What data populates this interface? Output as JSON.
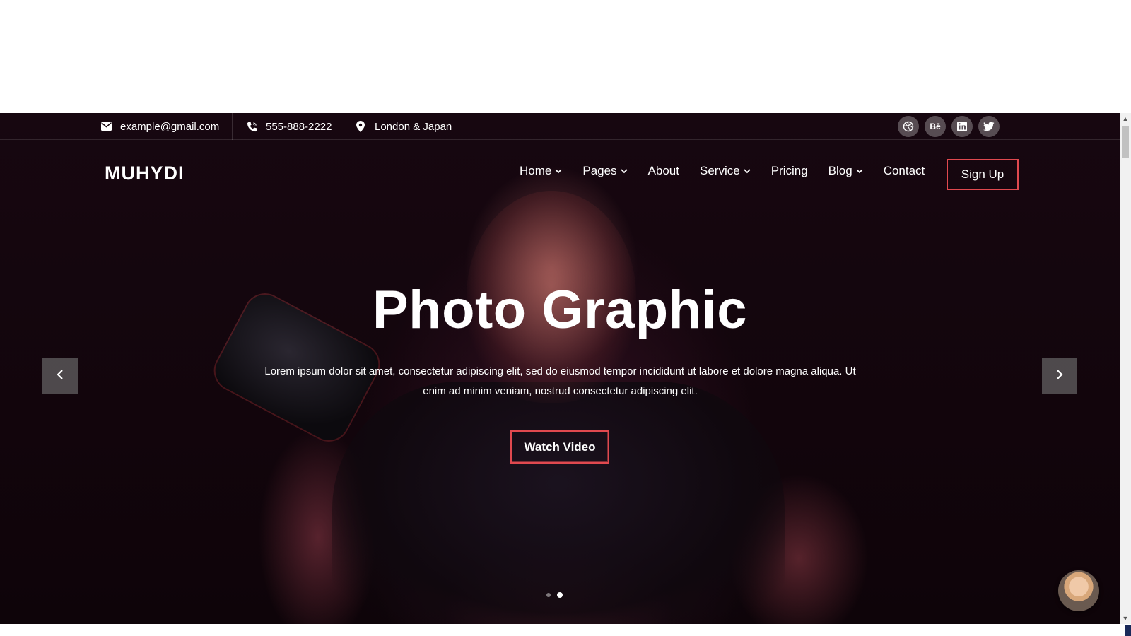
{
  "topbar": {
    "email": "example@gmail.com",
    "phone": "555-888-2222",
    "location": "London & Japan",
    "socials": [
      {
        "icon": "dribbble-icon",
        "label": ""
      },
      {
        "icon": "behance-icon",
        "label": "Bē"
      },
      {
        "icon": "linkedin-icon",
        "label": ""
      },
      {
        "icon": "twitter-icon",
        "label": ""
      }
    ]
  },
  "navbar": {
    "logo": "MUHYDI",
    "items": [
      {
        "label": "Home",
        "dropdown": true
      },
      {
        "label": "Pages",
        "dropdown": true
      },
      {
        "label": "About",
        "dropdown": false
      },
      {
        "label": "Service",
        "dropdown": true
      },
      {
        "label": "Pricing",
        "dropdown": false
      },
      {
        "label": "Blog",
        "dropdown": true
      },
      {
        "label": "Contact",
        "dropdown": false
      }
    ],
    "signup_label": "Sign Up"
  },
  "hero": {
    "title": "Photo Graphic",
    "text": "Lorem ipsum dolor sit amet, consectetur adipiscing elit, sed do eiusmod tempor incididunt ut labore et dolore magna aliqua. Ut enim ad minim veniam, nostrud consectetur adipiscing elit.",
    "button_label": "Watch Video",
    "slides_total": 2,
    "active_slide": 2
  },
  "colors": {
    "accent": "#e0494f",
    "hero_bg": "#12050c"
  }
}
